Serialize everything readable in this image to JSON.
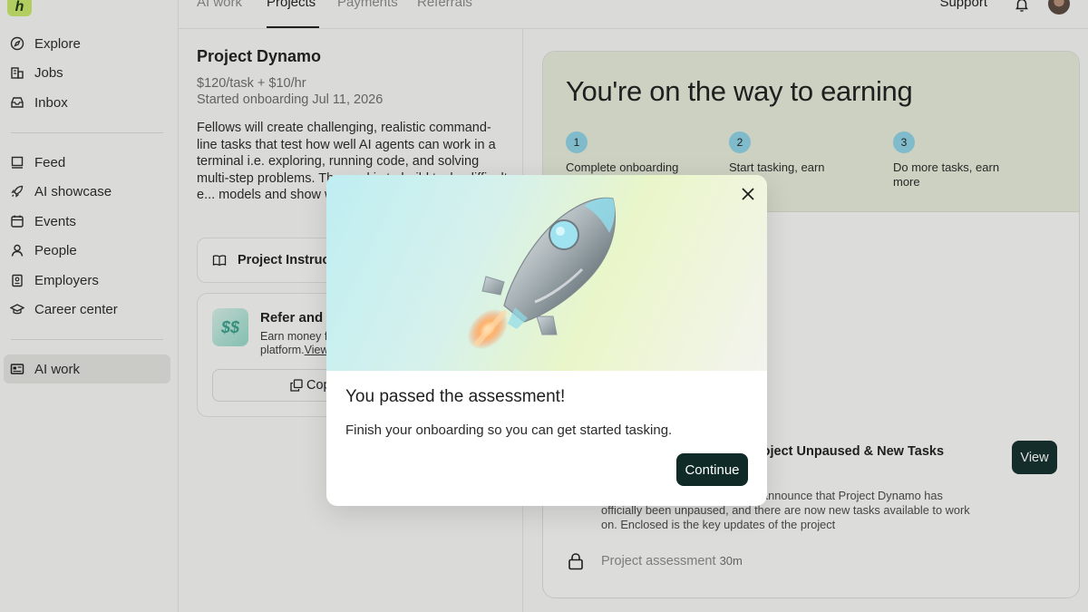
{
  "sidebar": {
    "logo_text": "h",
    "items": [
      {
        "label": "Explore",
        "icon": "compass-icon"
      },
      {
        "label": "Jobs",
        "icon": "building-icon"
      },
      {
        "label": "Inbox",
        "icon": "inbox-icon"
      },
      {
        "label": "Feed",
        "icon": "feed-icon"
      },
      {
        "label": "AI showcase",
        "icon": "rocket-icon"
      },
      {
        "label": "Events",
        "icon": "calendar-icon"
      },
      {
        "label": "People",
        "icon": "person-icon"
      },
      {
        "label": "Employers",
        "icon": "badge-icon"
      },
      {
        "label": "Career center",
        "icon": "graduation-cap-icon"
      },
      {
        "label": "AI work",
        "icon": "id-card-icon",
        "active": true
      }
    ]
  },
  "topbar": {
    "tabs": [
      "AI work",
      "Projects",
      "Payments",
      "Referrals"
    ],
    "active_tab": "Projects",
    "support_label": "Support"
  },
  "project": {
    "title": "Project Dynamo",
    "rate": "$120/task + $10/hr",
    "started": "Started onboarding Jul 11, 2026",
    "description": "Fellows will create challenging, realistic command-line tasks that test how well AI agents can work in a terminal i.e. exploring, running code, and solving multi-step problems. The goal is to build tasks difficult e... models and show wh...",
    "instructions_label": "Project Instruc",
    "refer": {
      "title": "Refer and",
      "text_1": "Earn money f",
      "text_2": "platform.",
      "link": "View",
      "copy_label": "Cop"
    }
  },
  "earning": {
    "title": "You're on the way to earning",
    "steps": [
      {
        "num": "1",
        "label": "Complete onboarding"
      },
      {
        "num": "2",
        "label": "Start tasking, earn"
      },
      {
        "num": "3",
        "label": "Do more tasks, earn more"
      }
    ],
    "news_title": "roject Unpaused & New Tasks",
    "view_label": "View",
    "news_body_line1": "announce that Project Dynamo has",
    "news_body_rest": "officially been unpaused, and there are now new tasks available to work on. Enclosed is the key updates of the project",
    "assessment_label": "Project assessment",
    "assessment_duration": "30m"
  },
  "modal": {
    "title": "You passed the assessment!",
    "text": "Finish your onboarding so you can get started tasking.",
    "continue_label": "Continue"
  },
  "colors": {
    "accent_dark": "#0f2a27",
    "earning_bg": "#e6ecd9",
    "step_badge": "#8fd3e6",
    "logo_green": "#c8e86a"
  }
}
